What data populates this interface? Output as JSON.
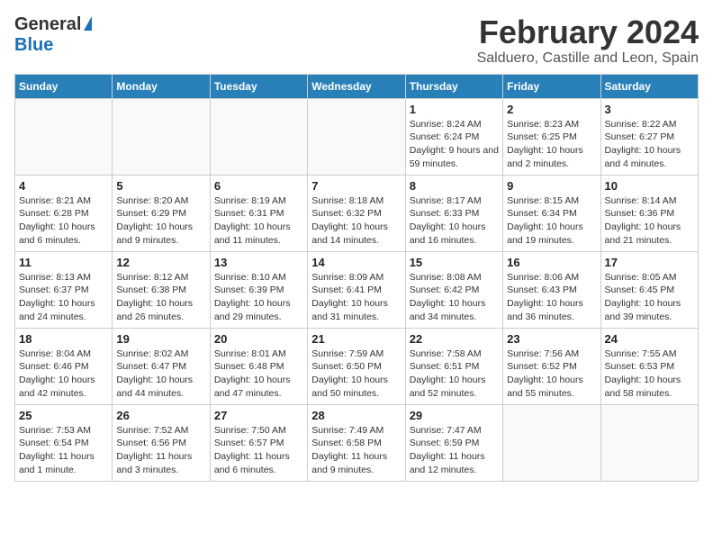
{
  "header": {
    "logo_general": "General",
    "logo_blue": "Blue",
    "month": "February 2024",
    "location": "Salduero, Castille and Leon, Spain"
  },
  "weekdays": [
    "Sunday",
    "Monday",
    "Tuesday",
    "Wednesday",
    "Thursday",
    "Friday",
    "Saturday"
  ],
  "weeks": [
    [
      {
        "day": "",
        "info": ""
      },
      {
        "day": "",
        "info": ""
      },
      {
        "day": "",
        "info": ""
      },
      {
        "day": "",
        "info": ""
      },
      {
        "day": "1",
        "info": "Sunrise: 8:24 AM\nSunset: 6:24 PM\nDaylight: 9 hours and 59 minutes."
      },
      {
        "day": "2",
        "info": "Sunrise: 8:23 AM\nSunset: 6:25 PM\nDaylight: 10 hours and 2 minutes."
      },
      {
        "day": "3",
        "info": "Sunrise: 8:22 AM\nSunset: 6:27 PM\nDaylight: 10 hours and 4 minutes."
      }
    ],
    [
      {
        "day": "4",
        "info": "Sunrise: 8:21 AM\nSunset: 6:28 PM\nDaylight: 10 hours and 6 minutes."
      },
      {
        "day": "5",
        "info": "Sunrise: 8:20 AM\nSunset: 6:29 PM\nDaylight: 10 hours and 9 minutes."
      },
      {
        "day": "6",
        "info": "Sunrise: 8:19 AM\nSunset: 6:31 PM\nDaylight: 10 hours and 11 minutes."
      },
      {
        "day": "7",
        "info": "Sunrise: 8:18 AM\nSunset: 6:32 PM\nDaylight: 10 hours and 14 minutes."
      },
      {
        "day": "8",
        "info": "Sunrise: 8:17 AM\nSunset: 6:33 PM\nDaylight: 10 hours and 16 minutes."
      },
      {
        "day": "9",
        "info": "Sunrise: 8:15 AM\nSunset: 6:34 PM\nDaylight: 10 hours and 19 minutes."
      },
      {
        "day": "10",
        "info": "Sunrise: 8:14 AM\nSunset: 6:36 PM\nDaylight: 10 hours and 21 minutes."
      }
    ],
    [
      {
        "day": "11",
        "info": "Sunrise: 8:13 AM\nSunset: 6:37 PM\nDaylight: 10 hours and 24 minutes."
      },
      {
        "day": "12",
        "info": "Sunrise: 8:12 AM\nSunset: 6:38 PM\nDaylight: 10 hours and 26 minutes."
      },
      {
        "day": "13",
        "info": "Sunrise: 8:10 AM\nSunset: 6:39 PM\nDaylight: 10 hours and 29 minutes."
      },
      {
        "day": "14",
        "info": "Sunrise: 8:09 AM\nSunset: 6:41 PM\nDaylight: 10 hours and 31 minutes."
      },
      {
        "day": "15",
        "info": "Sunrise: 8:08 AM\nSunset: 6:42 PM\nDaylight: 10 hours and 34 minutes."
      },
      {
        "day": "16",
        "info": "Sunrise: 8:06 AM\nSunset: 6:43 PM\nDaylight: 10 hours and 36 minutes."
      },
      {
        "day": "17",
        "info": "Sunrise: 8:05 AM\nSunset: 6:45 PM\nDaylight: 10 hours and 39 minutes."
      }
    ],
    [
      {
        "day": "18",
        "info": "Sunrise: 8:04 AM\nSunset: 6:46 PM\nDaylight: 10 hours and 42 minutes."
      },
      {
        "day": "19",
        "info": "Sunrise: 8:02 AM\nSunset: 6:47 PM\nDaylight: 10 hours and 44 minutes."
      },
      {
        "day": "20",
        "info": "Sunrise: 8:01 AM\nSunset: 6:48 PM\nDaylight: 10 hours and 47 minutes."
      },
      {
        "day": "21",
        "info": "Sunrise: 7:59 AM\nSunset: 6:50 PM\nDaylight: 10 hours and 50 minutes."
      },
      {
        "day": "22",
        "info": "Sunrise: 7:58 AM\nSunset: 6:51 PM\nDaylight: 10 hours and 52 minutes."
      },
      {
        "day": "23",
        "info": "Sunrise: 7:56 AM\nSunset: 6:52 PM\nDaylight: 10 hours and 55 minutes."
      },
      {
        "day": "24",
        "info": "Sunrise: 7:55 AM\nSunset: 6:53 PM\nDaylight: 10 hours and 58 minutes."
      }
    ],
    [
      {
        "day": "25",
        "info": "Sunrise: 7:53 AM\nSunset: 6:54 PM\nDaylight: 11 hours and 1 minute."
      },
      {
        "day": "26",
        "info": "Sunrise: 7:52 AM\nSunset: 6:56 PM\nDaylight: 11 hours and 3 minutes."
      },
      {
        "day": "27",
        "info": "Sunrise: 7:50 AM\nSunset: 6:57 PM\nDaylight: 11 hours and 6 minutes."
      },
      {
        "day": "28",
        "info": "Sunrise: 7:49 AM\nSunset: 6:58 PM\nDaylight: 11 hours and 9 minutes."
      },
      {
        "day": "29",
        "info": "Sunrise: 7:47 AM\nSunset: 6:59 PM\nDaylight: 11 hours and 12 minutes."
      },
      {
        "day": "",
        "info": ""
      },
      {
        "day": "",
        "info": ""
      }
    ]
  ]
}
